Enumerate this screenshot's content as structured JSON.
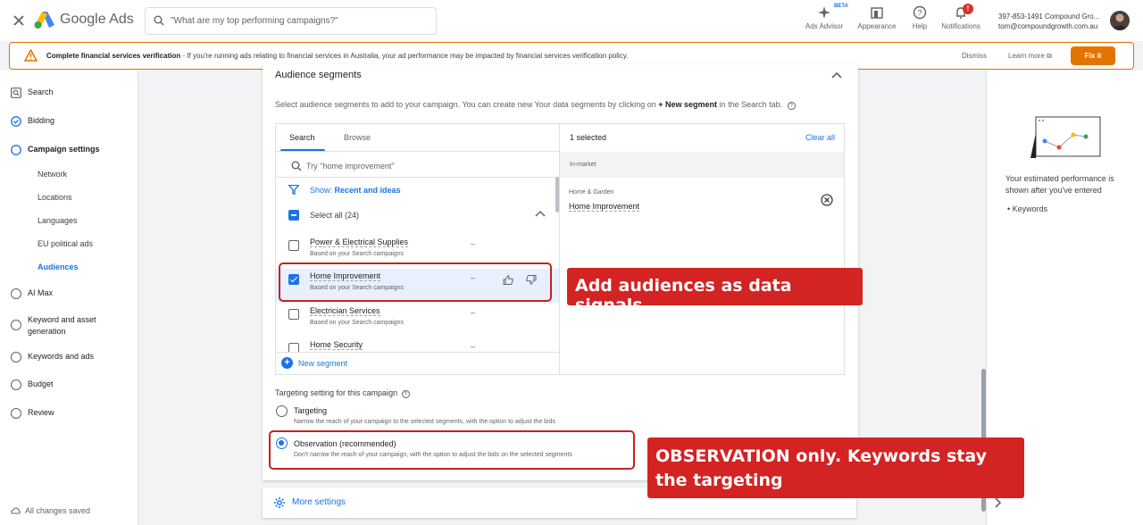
{
  "app": {
    "brand": "Google Ads"
  },
  "topbar": {
    "search_placeholder": "\"What are my top performing campaigns?\"",
    "items": [
      {
        "label": "Ads Advisor",
        "icon": "sparkle-icon"
      },
      {
        "label": "Appearance",
        "icon": "appearance-icon"
      },
      {
        "label": "Help",
        "icon": "help-icon"
      },
      {
        "label": "Notifications",
        "icon": "bell-icon"
      }
    ],
    "beta_label": "BETA",
    "notification_count": "!",
    "account_line1": "397-853-1491 Compound Gro...",
    "account_line2": "tom@compoundgrowth.com.au"
  },
  "banner": {
    "title": "Complete financial services verification",
    "text": " - If you're running ads relating to financial services in Australia, your ad performance may be impacted by financial services verification policy.",
    "dismiss": "Dismiss",
    "learn_more": "Learn more",
    "fix_it": "Fix it"
  },
  "nav": {
    "search": "Search",
    "bidding": "Bidding",
    "campaign_settings": "Campaign settings",
    "sub": [
      "Network",
      "Locations",
      "Languages",
      "EU political ads",
      "Audiences"
    ],
    "ai_max": "AI Max",
    "keyword_asset": "Keyword and asset generation",
    "keywords_ads": "Keywords and ads",
    "budget": "Budget",
    "review": "Review",
    "saved": "All changes saved"
  },
  "audience": {
    "title": "Audience segments",
    "desc_pre": "Select audience segments to add to your campaign. You can create new Your data segments by clicking on ",
    "desc_bold": "+ New segment",
    "desc_post": " in the Search tab.",
    "tab_search": "Search",
    "tab_browse": "Browse",
    "search_placeholder": "Try \"home improvement\"",
    "show_label": "Show: ",
    "show_value": "Recent and ideas",
    "select_all": "Select all (24)",
    "segments": [
      {
        "name": "Power & Electrical Supplies",
        "sub": "Based on your Search campaigns",
        "dash": "–",
        "checked": false
      },
      {
        "name": "Home Improvement",
        "sub": "Based on your Search campaigns",
        "dash": "–",
        "checked": true
      },
      {
        "name": "Electrician Services",
        "sub": "Based on your Search campaigns",
        "dash": "–",
        "checked": false
      },
      {
        "name": "Home Security",
        "sub": "",
        "dash": "–",
        "checked": false
      }
    ],
    "new_segment": "New segment",
    "selected_count": "1 selected",
    "clear_all": "Clear all",
    "selected_group": "In-market",
    "selected_category": "Home & Garden",
    "selected_item": "Home Improvement"
  },
  "targeting": {
    "title": "Targeting setting for this campaign",
    "targeting_label": "Targeting",
    "targeting_desc": "Narrow the reach of your campaign to the selected segments, with the option to adjust the bids",
    "observation_label": "Observation (recommended)",
    "observation_desc": "Don't narrow the reach of your campaign, with the option to adjust the bids on the selected segments",
    "selected": "observation"
  },
  "more_settings": "More settings",
  "right_panel": {
    "text": "Your estimated performance is shown after you've entered",
    "bullet": "Keywords"
  },
  "callouts": {
    "one": "Add audiences as data signals",
    "two": "OBSERVATION only. Keywords stay the targeting"
  },
  "colors": {
    "accent": "#1a73e8",
    "warning": "#e37400",
    "callout": "#d32323"
  }
}
